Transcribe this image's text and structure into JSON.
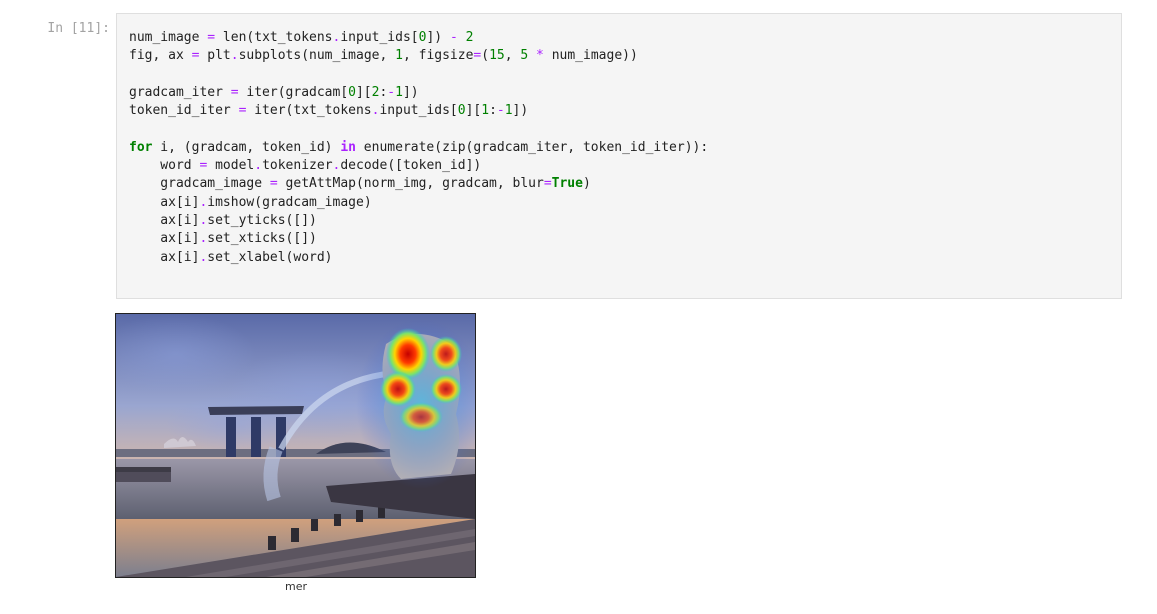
{
  "cell": {
    "prompt": "In [11]:",
    "lines": [
      "num_image = len(txt_tokens.input_ids[0]) - 2",
      "fig, ax = plt.subplots(num_image, 1, figsize=(15, 5 * num_image))",
      "",
      "gradcam_iter = iter(gradcam[0][2:-1])",
      "token_id_iter = iter(txt_tokens.input_ids[0][1:-1])",
      "",
      "for i, (gradcam, token_id) in enumerate(zip(gradcam_iter, token_id_iter)):",
      "    word = model.tokenizer.decode([token_id])",
      "    gradcam_image = getAttMap(norm_img, gradcam, blur=True)",
      "    ax[i].imshow(gradcam_image)",
      "    ax[i].set_yticks([])",
      "    ax[i].set_xticks([])",
      "    ax[i].set_xlabel(word)"
    ]
  },
  "output": {
    "xlabel": "mer",
    "image_description_icon": "merlion-gradcam-heatmap"
  }
}
